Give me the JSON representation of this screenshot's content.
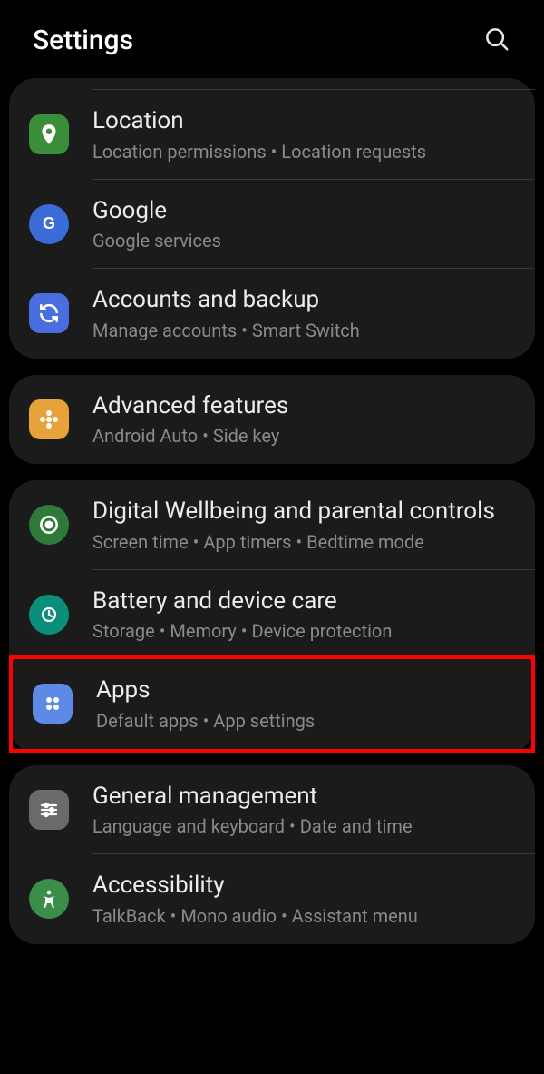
{
  "header": {
    "title": "Settings"
  },
  "groups": [
    {
      "items": [
        {
          "key": "location",
          "title": "Location",
          "sub": "Location permissions  •  Location requests"
        },
        {
          "key": "google",
          "title": "Google",
          "sub": "Google services"
        },
        {
          "key": "accounts",
          "title": "Accounts and backup",
          "sub": "Manage accounts  •  Smart Switch"
        }
      ]
    },
    {
      "items": [
        {
          "key": "advanced",
          "title": "Advanced features",
          "sub": "Android Auto  •  Side key"
        }
      ]
    },
    {
      "items": [
        {
          "key": "wellbeing",
          "title": "Digital Wellbeing and parental controls",
          "sub": "Screen time  •  App timers  •  Bedtime mode"
        },
        {
          "key": "battery",
          "title": "Battery and device care",
          "sub": "Storage  •  Memory  •  Device protection"
        },
        {
          "key": "apps",
          "title": "Apps",
          "sub": "Default apps  •  App settings"
        }
      ]
    },
    {
      "items": [
        {
          "key": "general",
          "title": "General management",
          "sub": "Language and keyboard  •  Date and time"
        },
        {
          "key": "accessibility",
          "title": "Accessibility",
          "sub": "TalkBack  •  Mono audio  •  Assistant menu"
        }
      ]
    }
  ]
}
